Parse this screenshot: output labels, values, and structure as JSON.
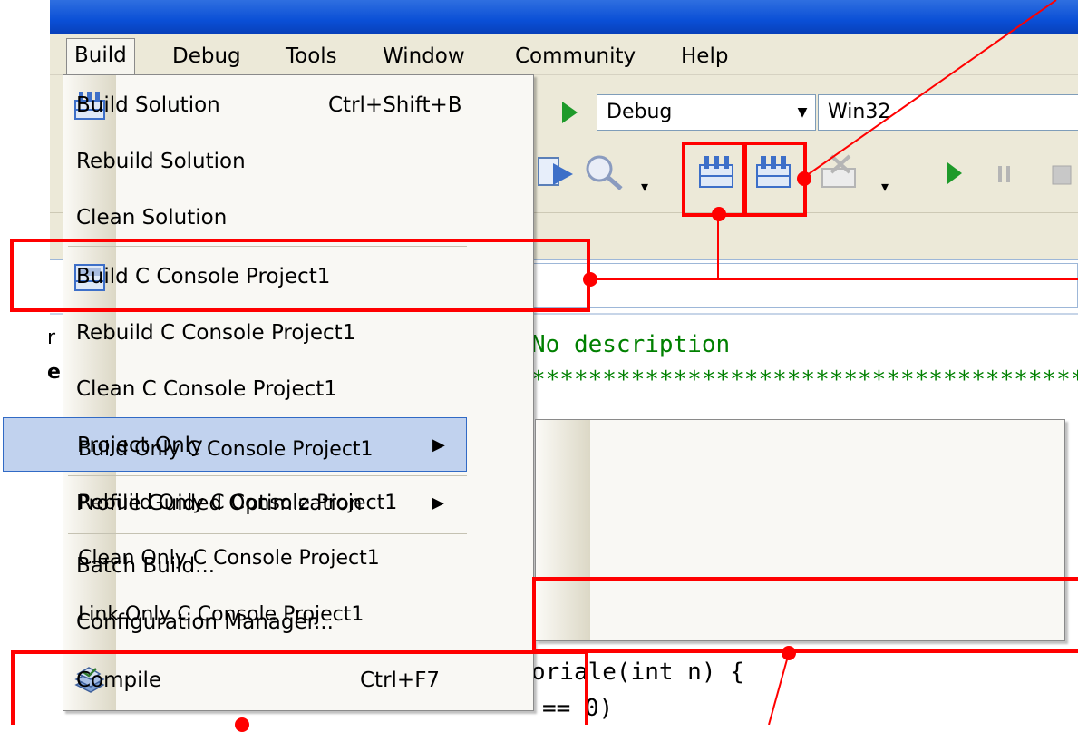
{
  "menubar": {
    "items": [
      "Build",
      "Debug",
      "Tools",
      "Window",
      "Community",
      "Help"
    ]
  },
  "toolbar": {
    "configuration": "Debug",
    "platform": "Win32"
  },
  "build_menu": {
    "items": [
      {
        "label": "Build Solution",
        "shortcut": "Ctrl+Shift+B",
        "icon": "build-solution-icon"
      },
      {
        "label": "Rebuild Solution"
      },
      {
        "label": "Clean Solution"
      },
      {
        "label": "Build C Console Project1",
        "icon": "build-project-icon"
      },
      {
        "label": "Rebuild C Console Project1"
      },
      {
        "label": "Clean C Console Project1"
      },
      {
        "label": "Project Only",
        "submenu": true
      },
      {
        "label": "Profile Guided Optimization",
        "submenu": true
      },
      {
        "label": "Batch Build..."
      },
      {
        "label": "Configuration Manager..."
      },
      {
        "label": "Compile",
        "shortcut": "Ctrl+F7",
        "icon": "compile-icon"
      }
    ]
  },
  "submenu": {
    "items": [
      "Build Only C Console Project1",
      "Rebuild Only C Console Project1",
      "Clean Only C Console Project1",
      "Link Only C Console Project1"
    ]
  },
  "code": {
    "line1": "No description",
    "line2": "*****************************************",
    "line3": "oriale(int n) {",
    "line4": "== 0)",
    "left_fragment1": "r",
    "left_fragment2": "e"
  },
  "colors": {
    "annotation": "#ff0000",
    "highlight": "#c1d2ee",
    "code_comment": "#008000"
  }
}
